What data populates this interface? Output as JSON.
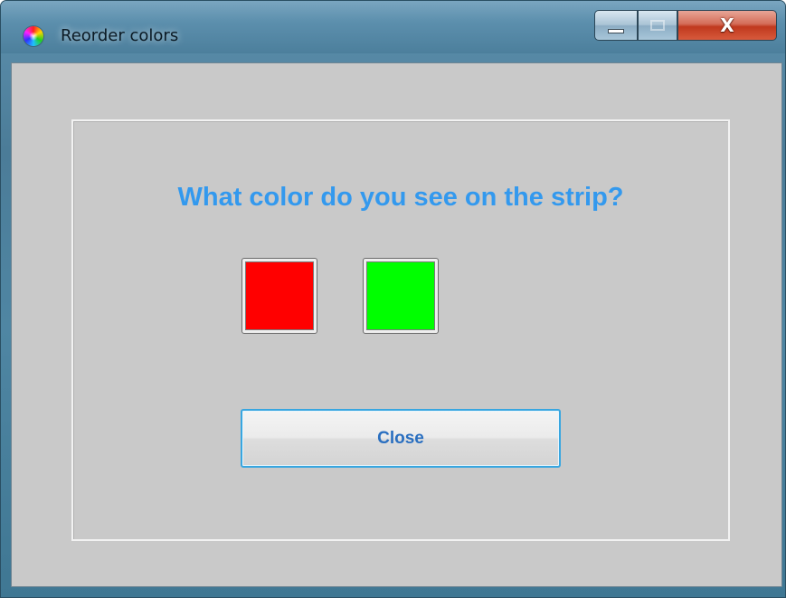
{
  "window": {
    "title": "Reorder colors",
    "title_icon": "color-wheel-icon",
    "caption": {
      "minimize_icon": "minimize-icon",
      "maximize_icon": "maximize-icon",
      "close_glyph": "X"
    }
  },
  "dialog": {
    "question": "What color do you see on the strip?",
    "swatches": [
      {
        "color": "#ff0000"
      },
      {
        "color": "#00ff00"
      }
    ],
    "close_label": "Close"
  },
  "colors": {
    "accent_text": "#3399ee",
    "button_text": "#2a6fc0",
    "client_background": "#c9c9c9"
  }
}
